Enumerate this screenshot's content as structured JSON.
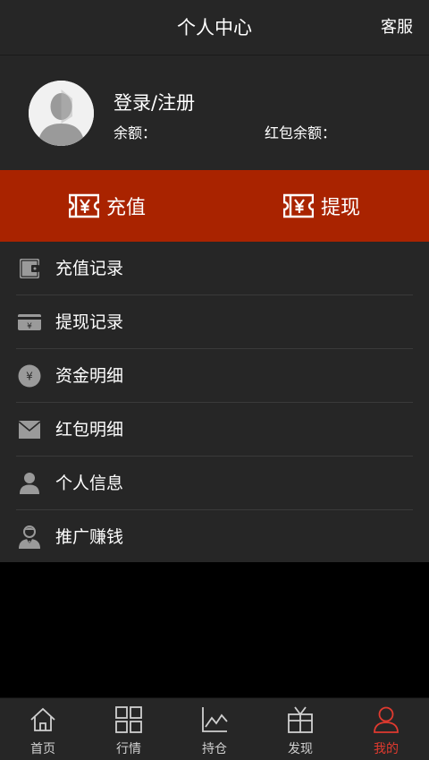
{
  "header": {
    "title": "个人中心",
    "right_button": "客服"
  },
  "profile": {
    "login_label": "登录/注册",
    "balance_label": "余额：",
    "redpacket_balance_label": "红包余额："
  },
  "actions": [
    {
      "label": "充值",
      "icon": "yen-voucher-icon"
    },
    {
      "label": "提现",
      "icon": "yen-voucher-icon"
    }
  ],
  "menu": {
    "items": [
      {
        "label": "充值记录",
        "icon": "wallet-icon"
      },
      {
        "label": "提现记录",
        "icon": "yen-card-icon"
      },
      {
        "label": "资金明细",
        "icon": "yen-coin-icon"
      },
      {
        "label": "红包明细",
        "icon": "envelope-icon"
      },
      {
        "label": "个人信息",
        "icon": "person-icon"
      },
      {
        "label": "推广赚钱",
        "icon": "agent-icon"
      }
    ]
  },
  "tabbar": {
    "active_index": 4,
    "active_color": "#e03a2f",
    "items": [
      {
        "label": "首页",
        "icon": "home-icon"
      },
      {
        "label": "行情",
        "icon": "grid-icon"
      },
      {
        "label": "持仓",
        "icon": "chart-icon"
      },
      {
        "label": "发现",
        "icon": "gift-icon"
      },
      {
        "label": "我的",
        "icon": "user-icon"
      }
    ]
  },
  "colors": {
    "action_bar": "#a92300",
    "panel": "#262626",
    "background": "#000000"
  }
}
